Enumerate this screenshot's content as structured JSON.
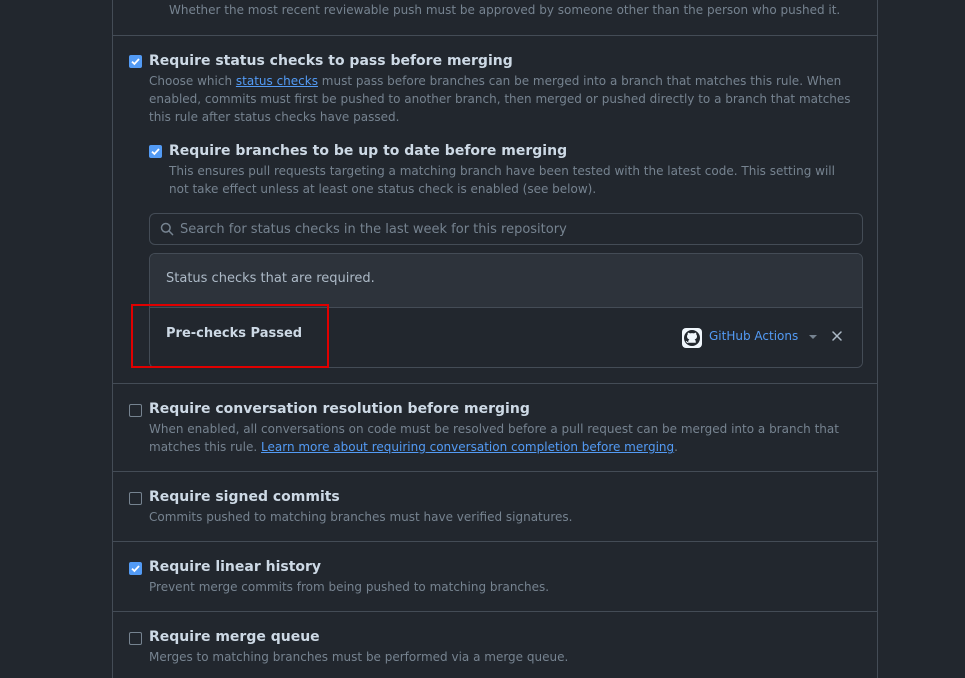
{
  "top_fragment": {
    "text": "Whether the most recent reviewable push must be approved by someone other than the person who pushed it."
  },
  "status_checks": {
    "checked": true,
    "title": "Require status checks to pass before merging",
    "desc_pre": "Choose which ",
    "desc_link": "status checks",
    "desc_post": " must pass before branches can be merged into a branch that matches this rule. When enabled, commits must first be pushed to another branch, then merged or pushed directly to a branch that matches this rule after status checks have passed.",
    "up_to_date": {
      "checked": true,
      "title": "Require branches to be up to date before merging",
      "desc": "This ensures pull requests targeting a matching branch have been tested with the latest code. This setting will not take effect unless at least one status check is enabled (see below)."
    },
    "search_placeholder": "Search for status checks in the last week for this repository",
    "required_header": "Status checks that are required.",
    "required_items": [
      {
        "name": "Pre-checks Passed",
        "source": "GitHub Actions",
        "source_icon": "github-icon"
      }
    ]
  },
  "conversation": {
    "checked": false,
    "title": "Require conversation resolution before merging",
    "desc": "When enabled, all conversations on code must be resolved before a pull request can be merged into a branch that matches this rule.",
    "link": "Learn more about requiring conversation completion before merging",
    "desc_post": "."
  },
  "signed": {
    "checked": false,
    "title": "Require signed commits",
    "desc": "Commits pushed to matching branches must have verified signatures."
  },
  "linear": {
    "checked": true,
    "title": "Require linear history",
    "desc": "Prevent merge commits from being pushed to matching branches."
  },
  "merge_queue": {
    "checked": false,
    "title": "Require merge queue",
    "desc": "Merges to matching branches must be performed via a merge queue."
  },
  "colors": {
    "background": "#22272e",
    "accent": "#539bf5",
    "highlight": "#e00000"
  }
}
